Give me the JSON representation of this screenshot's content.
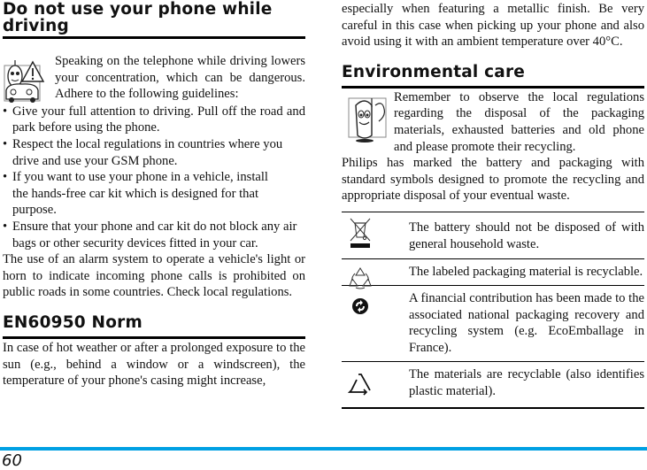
{
  "page_number": "60",
  "accent_color": "#00a0e3",
  "left": {
    "driving": {
      "title": "Do not use your phone while driving",
      "intro": "Speaking on the telephone while driving lowers your concentration, which can be dangerous. Adhere to the following guidelines:",
      "icon": "phone-driving-warning-icon",
      "bullets": [
        "Give your full attention to driving. Pull off the road and park before using the phone.",
        "Respect the local regulations in countries where you drive and use your GSM phone.",
        "If you want to use your phone in a vehicle, install the hands-free car kit which is designed for that purpose.",
        "Ensure that your phone and car kit do not block any air bags or other security devices fitted in your car."
      ],
      "note": "The use of an alarm system to operate a vehicle's light or horn to indicate incoming phone calls is prohibited on public roads in some countries. Check local regulations."
    },
    "norm": {
      "title": "EN60950 Norm",
      "text_part1": "In case of hot weather or after a prolonged exposure to the sun (e.g., behind a window or a windscreen), the temperature of your phone's casing might increase,"
    }
  },
  "right": {
    "norm_continued": "especially when featuring a metallic finish. Be very careful in this case when picking up your phone and also avoid using it with an ambient temperature over 40°C.",
    "env": {
      "title": "Environmental care",
      "intro": "Remember to observe the local regulations regarding the disposal of the packaging materials, exhausted batteries and old phone and please promote their recycling.",
      "icon": "phone-waving-icon",
      "text": "Philips has marked the battery and packaging with standard symbols designed to promote the recycling and appropriate disposal of your eventual waste.",
      "symbols": [
        {
          "icon": "crossed-bin-icon",
          "text": "The battery should not be disposed of with general household waste."
        },
        {
          "icon": "recycle-arrows-icon",
          "text": "The labeled packaging material is recyclable."
        },
        {
          "icon": "green-dot-icon",
          "text": "A financial contribution has been made to the associated national packaging recovery and recycling system (e.g. EcoEmballage in France)."
        },
        {
          "icon": "recycle-triangle-icon",
          "text": "The materials are recyclable (also identifies plastic material)."
        }
      ]
    }
  }
}
